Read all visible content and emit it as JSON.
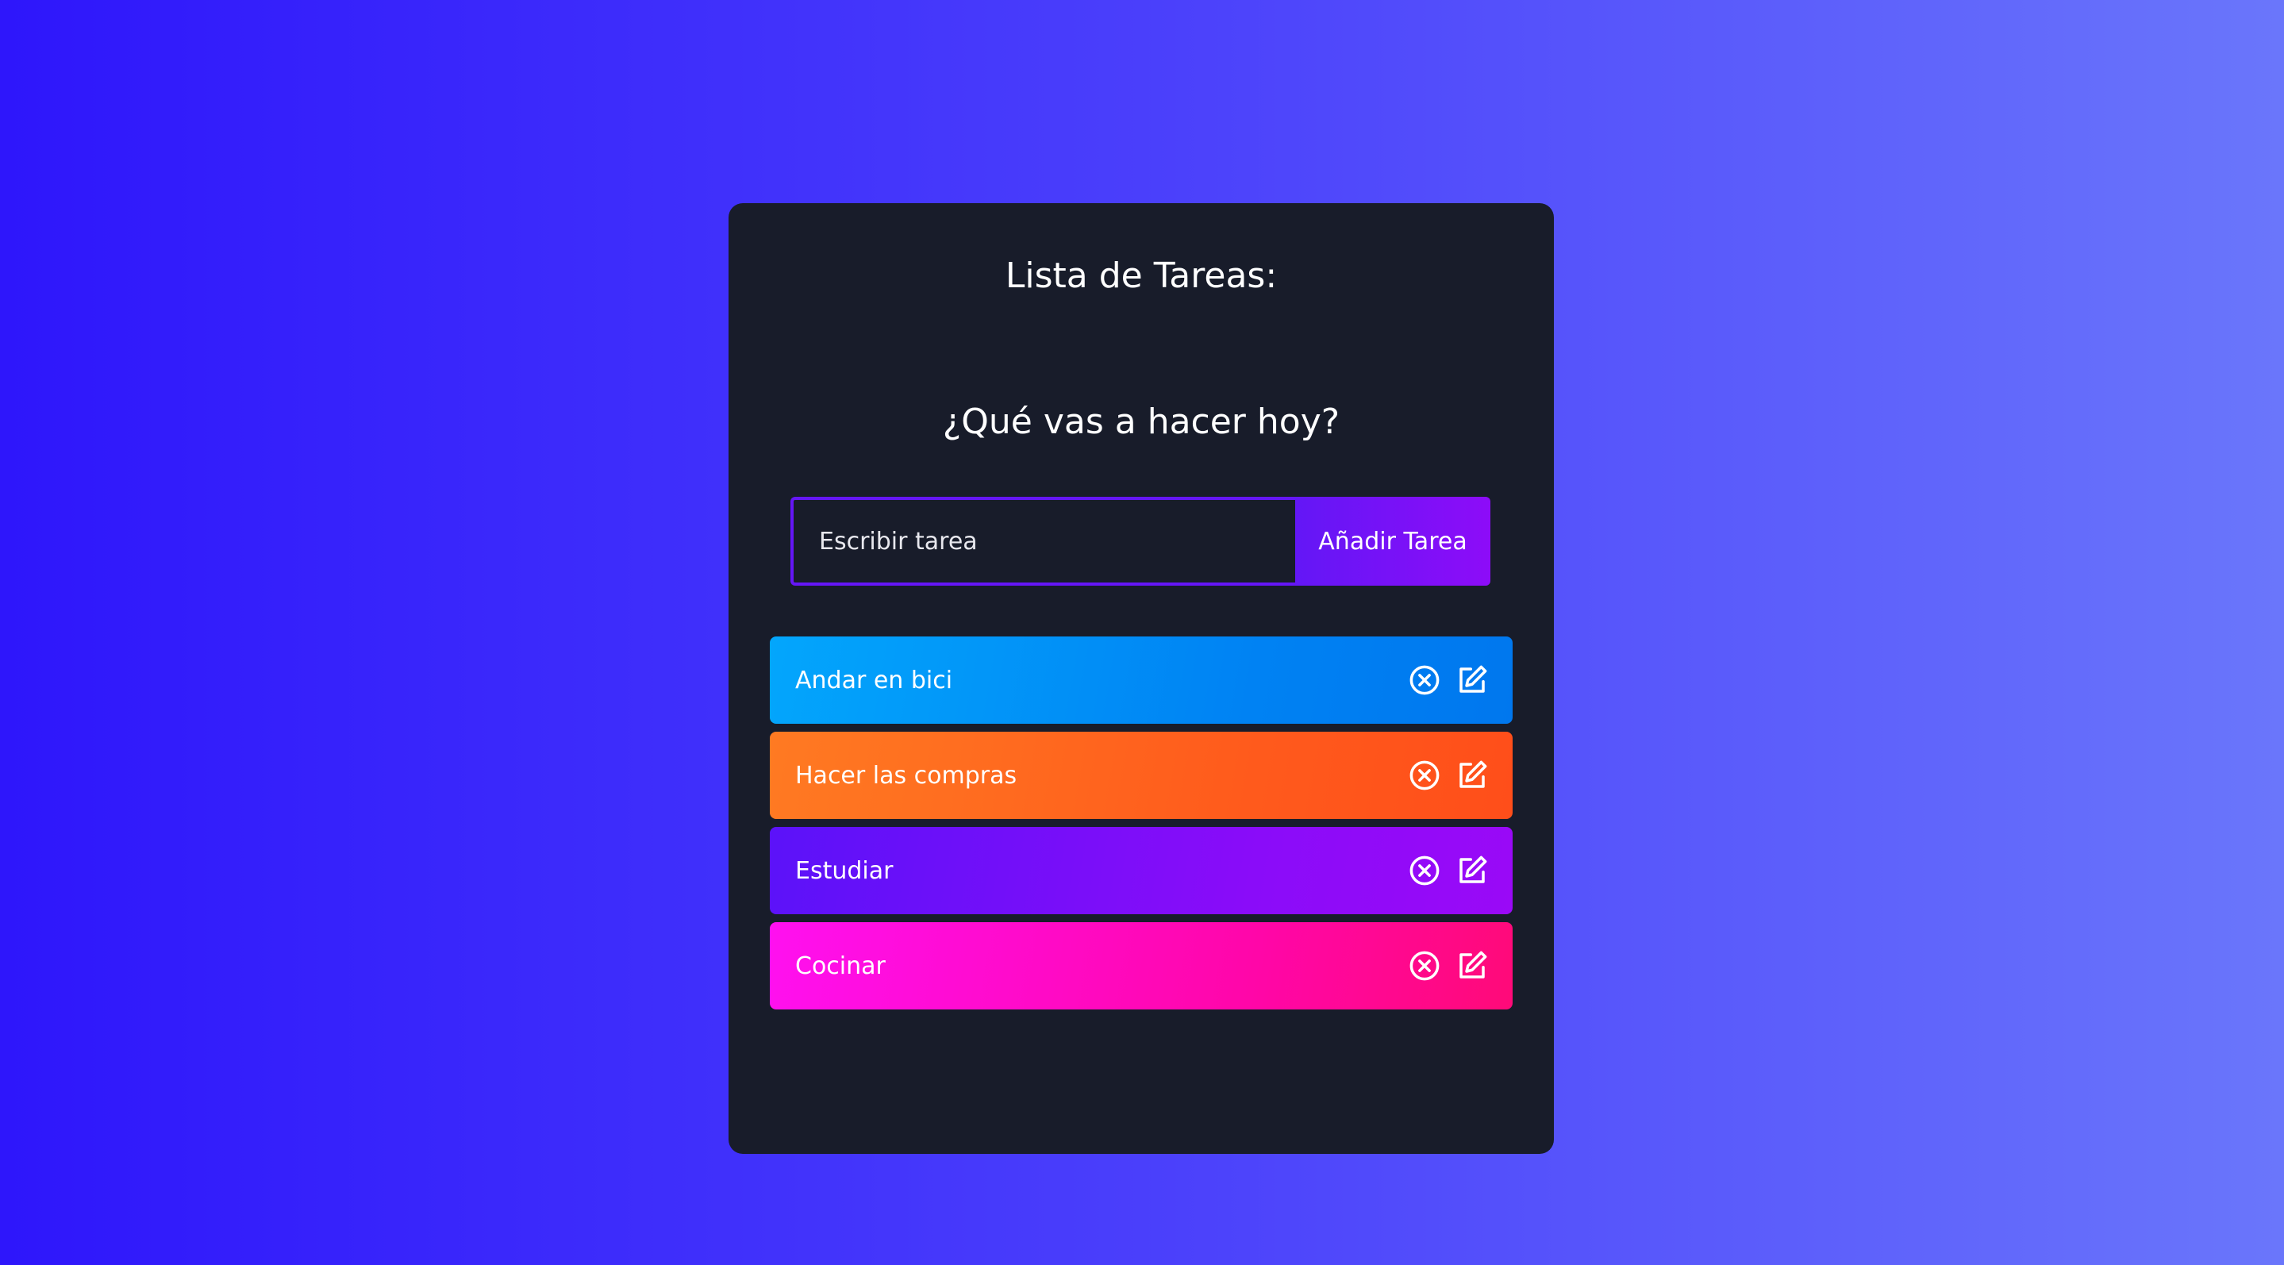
{
  "app": {
    "title": "Lista de Tareas:",
    "subtitle": "¿Qué vas a hacer hoy?"
  },
  "form": {
    "placeholder": "Escribir tarea",
    "button_label": "Añadir Tarea"
  },
  "tasks": [
    {
      "label": "Andar en bici",
      "color": "#0088f6"
    },
    {
      "label": "Hacer las compras",
      "color": "#ff661f"
    },
    {
      "label": "Estudiar",
      "color": "#760ff9"
    },
    {
      "label": "Cocinar",
      "color": "#ff08c4"
    }
  ],
  "icons": {
    "delete": "close-circle-icon",
    "edit": "edit-icon"
  },
  "colors": {
    "background_start": "#2e16fb",
    "background_end": "#6a76fb",
    "card": "#181c2a",
    "accent": "#6516f6"
  }
}
